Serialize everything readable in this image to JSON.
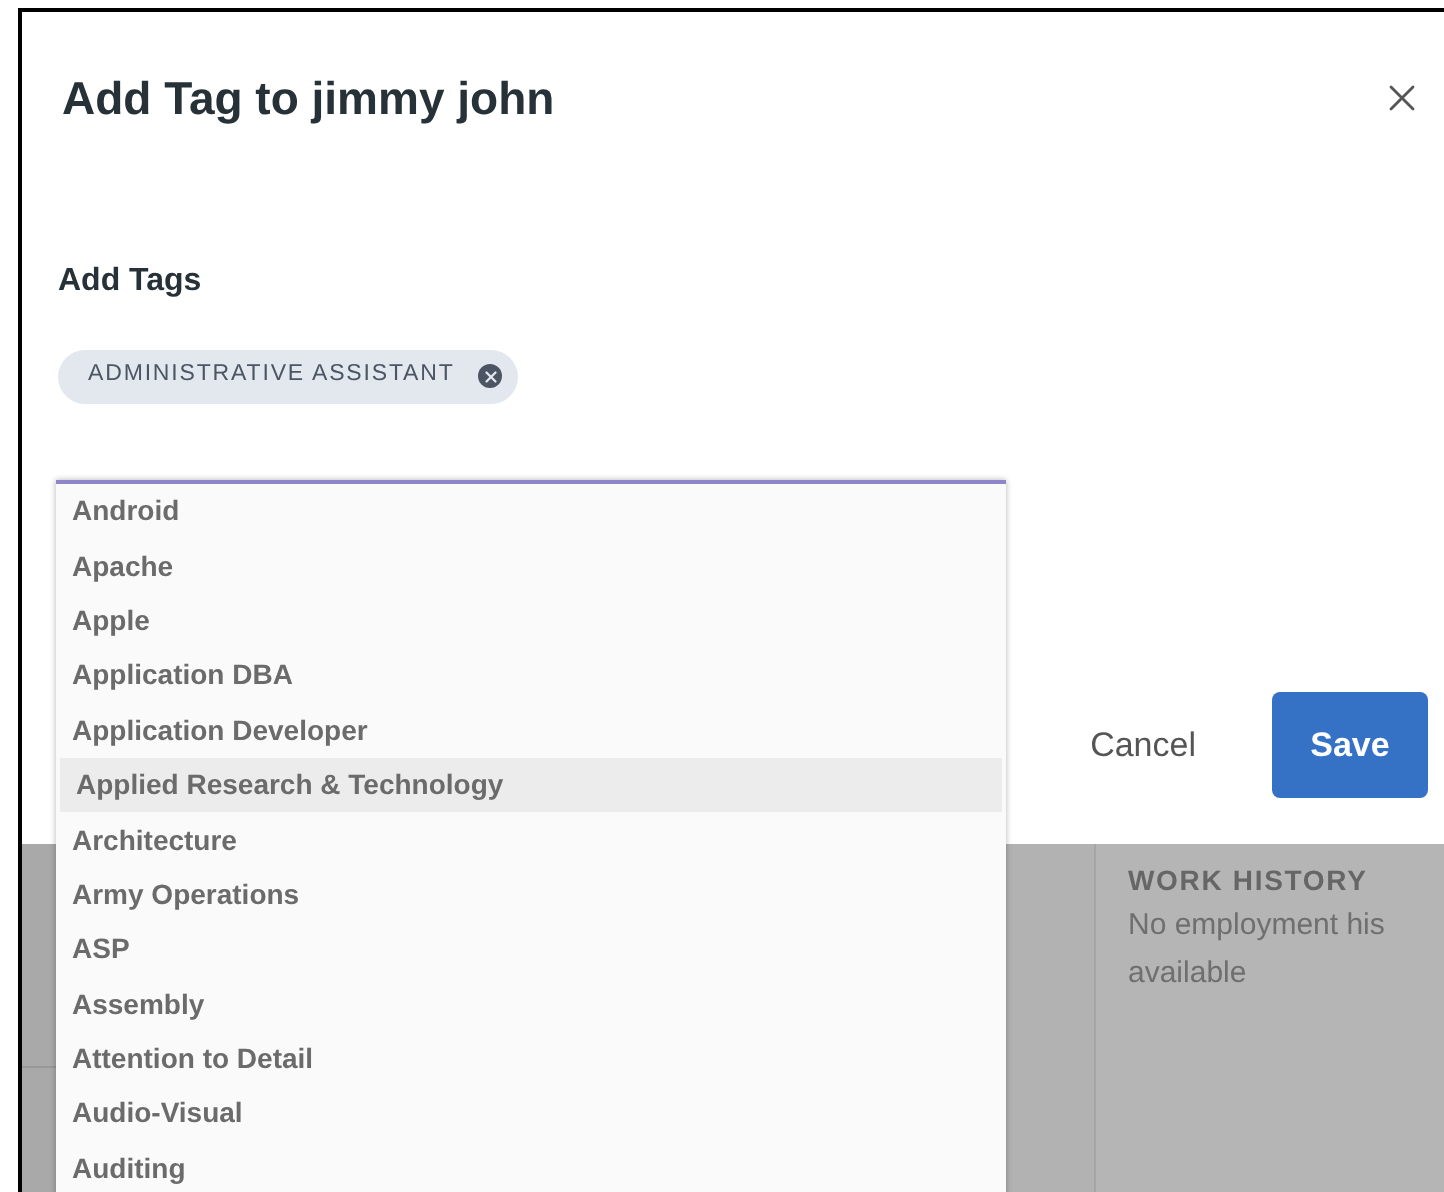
{
  "dialog": {
    "title": "Add Tag to jimmy john",
    "field_label": "Add Tags",
    "tags": [
      {
        "label": "ADMINISTRATIVE ASSISTANT"
      }
    ],
    "options": [
      {
        "label": "Android",
        "selected": false
      },
      {
        "label": "Apache",
        "selected": false
      },
      {
        "label": "Apple",
        "selected": false
      },
      {
        "label": "Application DBA",
        "selected": false
      },
      {
        "label": "Application Developer",
        "selected": false
      },
      {
        "label": "Applied Research & Technology",
        "selected": true
      },
      {
        "label": "Architecture",
        "selected": false
      },
      {
        "label": "Army Operations",
        "selected": false
      },
      {
        "label": "ASP",
        "selected": false
      },
      {
        "label": "Assembly",
        "selected": false
      },
      {
        "label": "Attention to Detail",
        "selected": false
      },
      {
        "label": "Audio-Visual",
        "selected": false
      },
      {
        "label": "Auditing",
        "selected": false
      }
    ],
    "buttons": {
      "cancel": "Cancel",
      "save": "Save"
    }
  },
  "background_page": {
    "section_heading": "WORK HISTORY",
    "empty_text": "No employment his available"
  }
}
